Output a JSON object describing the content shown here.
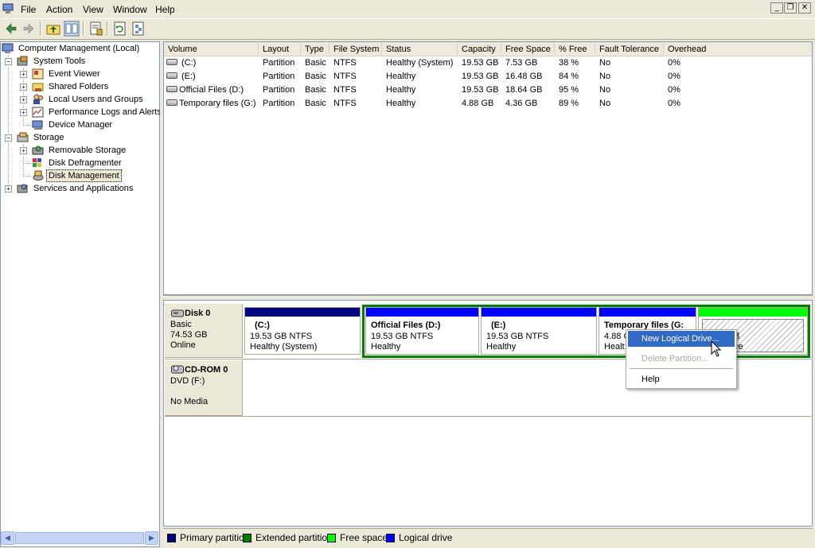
{
  "menu": {
    "items": [
      "File",
      "Action",
      "View",
      "Window",
      "Help"
    ]
  },
  "window_controls": {
    "minimize": "_",
    "restore": "❐",
    "close": "✕"
  },
  "toolbar": {
    "icons": [
      "back-icon",
      "forward-icon",
      "up-folder-icon",
      "show-hide-tree-icon",
      "properties-icon",
      "refresh-icon",
      "help-icon"
    ]
  },
  "tree": {
    "root": "Computer Management (Local)",
    "system_tools": {
      "label": "System Tools",
      "children": [
        "Event Viewer",
        "Shared Folders",
        "Local Users and Groups",
        "Performance Logs and Alerts",
        "Device Manager"
      ]
    },
    "storage": {
      "label": "Storage",
      "children": [
        "Removable Storage",
        "Disk Defragmenter",
        "Disk Management"
      ]
    },
    "services": "Services and Applications",
    "selected": "Disk Management"
  },
  "volumes": {
    "columns": [
      "Volume",
      "Layout",
      "Type",
      "File System",
      "Status",
      "Capacity",
      "Free Space",
      "% Free",
      "Fault Tolerance",
      "Overhead"
    ],
    "rows": [
      [
        "(C:)",
        "Partition",
        "Basic",
        "NTFS",
        "Healthy (System)",
        "19.53 GB",
        "7.53 GB",
        "38 %",
        "No",
        "0%"
      ],
      [
        "(E:)",
        "Partition",
        "Basic",
        "NTFS",
        "Healthy",
        "19.53 GB",
        "16.48 GB",
        "84 %",
        "No",
        "0%"
      ],
      [
        "Official Files (D:)",
        "Partition",
        "Basic",
        "NTFS",
        "Healthy",
        "19.53 GB",
        "18.64 GB",
        "95 %",
        "No",
        "0%"
      ],
      [
        "Temporary files (G:)",
        "Partition",
        "Basic",
        "NTFS",
        "Healthy",
        "4.88 GB",
        "4.36 GB",
        "89 %",
        "No",
        "0%"
      ]
    ]
  },
  "disks": {
    "disk0": {
      "name": "Disk 0",
      "type": "Basic",
      "size": "74.53 GB",
      "status": "Online",
      "partitions": [
        {
          "name": "(C:)",
          "size": "19.53 GB NTFS",
          "status": "Healthy (System)"
        },
        {
          "name": "Official Files  (D:)",
          "size": "19.53 GB NTFS",
          "status": "Healthy"
        },
        {
          "name": "(E:)",
          "size": "19.53 GB NTFS",
          "status": "Healthy"
        },
        {
          "name": "Temporary files  (G:",
          "size": "4.88 G",
          "status": "Healt"
        },
        {
          "size_fragment": "B",
          "status_fragment": "ce"
        }
      ]
    },
    "cdrom0": {
      "name": "CD-ROM 0",
      "drive": "DVD (F:)",
      "status": "No Media"
    }
  },
  "legend": [
    "Primary partition",
    "Extended partition",
    "Free space",
    "Logical drive"
  ],
  "colors": {
    "primary": "#000080",
    "extended": "#008000",
    "free": "#00ff00",
    "logical": "#0000ff",
    "highlight": "#316ac5"
  },
  "context_menu": {
    "items": [
      "New Logical Drive...",
      "Delete Partition...",
      "Help"
    ]
  }
}
